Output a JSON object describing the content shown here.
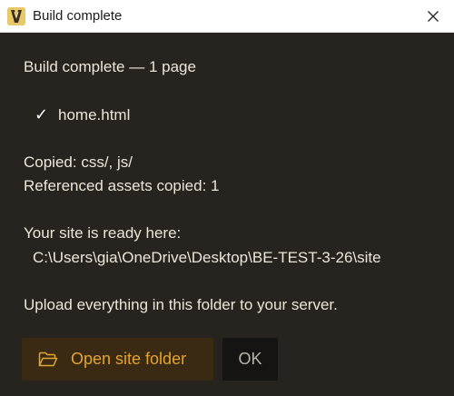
{
  "window": {
    "title": "Build complete",
    "app_icon": "app-logo-icon",
    "close_icon": "close-icon"
  },
  "content": {
    "heading": "Build complete — 1 page",
    "check_mark": "✓",
    "file": "home.html",
    "copied": "Copied: css/, js/",
    "assets": "Referenced assets copied: 1",
    "ready_label": "Your site is ready here:",
    "path": "C:\\Users\\gia\\OneDrive\\Desktop\\BE-TEST-3-26\\site",
    "upload_note": "Upload everything in this folder to your server."
  },
  "buttons": {
    "open_folder_label": "Open site folder",
    "open_folder_icon": "folder-open-icon",
    "ok_label": "OK"
  },
  "colors": {
    "background": "#272420",
    "titlebar": "#ffffff",
    "text": "#ece6da",
    "accent": "#e3a52e",
    "primary_button_bg": "#3a2a14",
    "secondary_button_bg": "#151412"
  }
}
